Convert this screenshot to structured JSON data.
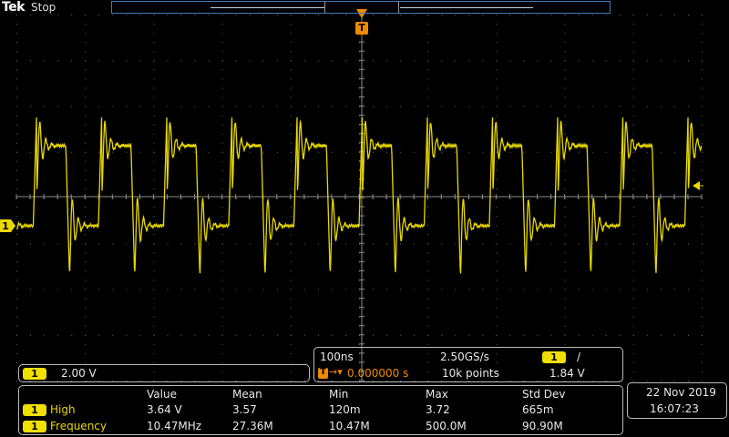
{
  "header": {
    "brand": "Tek",
    "run_state": "Stop"
  },
  "trigger": {
    "marker_label": "T",
    "level_arrow": "◀"
  },
  "channel": {
    "id": "1",
    "scale": "2.00 V",
    "color": "#e8d800"
  },
  "horizontal": {
    "time_per_div": "100ns",
    "sample_rate": "2.50GS/s",
    "trigger_channel": "1",
    "trigger_slope": "/",
    "trigger_glyph": "T",
    "position_arrow": "→▾",
    "position": "0.000000 s",
    "record_length": "10k points",
    "trigger_level": "1.84 V"
  },
  "measurements": {
    "columns": [
      "Value",
      "Mean",
      "Min",
      "Max",
      "Std Dev"
    ],
    "rows": [
      {
        "channel": "1",
        "name": "High",
        "value": "3.64 V",
        "mean": "3.57",
        "min": "120m",
        "max": "3.72",
        "std_dev": "665m"
      },
      {
        "channel": "1",
        "name": "Frequency",
        "value": "10.47MHz",
        "mean": "27.36M",
        "min": "10.47M",
        "max": "500.0M",
        "std_dev": "90.90M"
      }
    ]
  },
  "datetime": {
    "date": "22 Nov 2019",
    "time": "16:07:23"
  },
  "colors": {
    "trace": "#e8d800",
    "trigger": "#f08a00",
    "record_border": "#4a79b9",
    "panel_border": "#bcbcbc"
  }
}
